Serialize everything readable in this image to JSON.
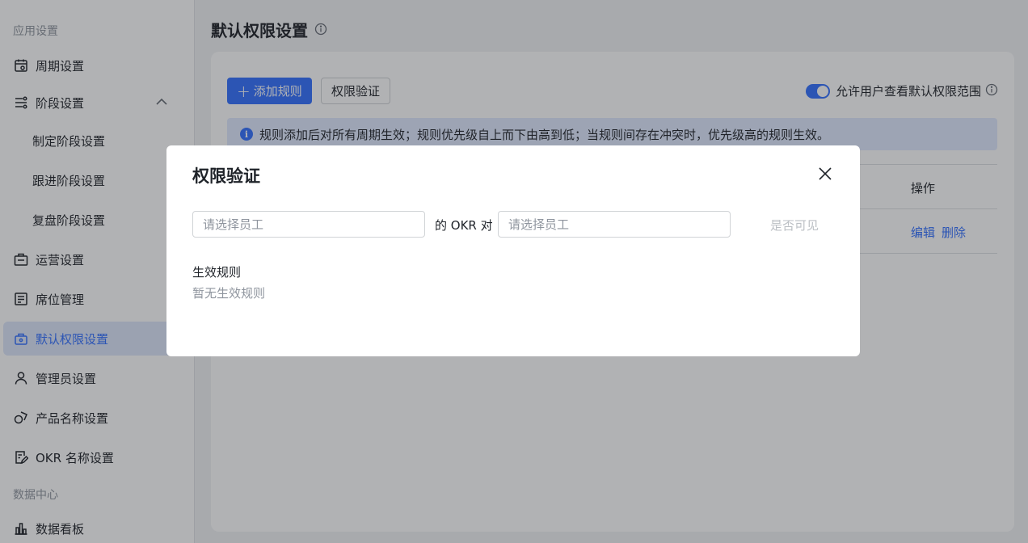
{
  "sidebar": {
    "group_app": "应用设置",
    "group_data": "数据中心",
    "items": [
      {
        "label": "周期设置",
        "icon": "calendar-icon"
      },
      {
        "label": "阶段设置",
        "icon": "stage-icon"
      },
      {
        "label": "制定阶段设置"
      },
      {
        "label": "跟进阶段设置"
      },
      {
        "label": "复盘阶段设置"
      },
      {
        "label": "运营设置",
        "icon": "briefcase-icon"
      },
      {
        "label": "席位管理",
        "icon": "seat-list-icon"
      },
      {
        "label": "默认权限设置",
        "icon": "lock-bag-icon"
      },
      {
        "label": "管理员设置",
        "icon": "user-icon"
      },
      {
        "label": "产品名称设置",
        "icon": "shapes-icon"
      },
      {
        "label": "OKR 名称设置",
        "icon": "edit-doc-icon"
      },
      {
        "label": "数据看板",
        "icon": "bar-chart-icon"
      }
    ]
  },
  "main": {
    "title": "默认权限设置",
    "add_rule_label": "添加规则",
    "verify_label": "权限验证",
    "toggle_label": "允许用户查看默认权限范围",
    "toggle_on": true,
    "notice": "规则添加后对所有周期生效；规则优先级自上而下由高到低；当规则间存在冲突时，优先级高的规则生效。",
    "column_ops": "操作",
    "row_edit": "编辑",
    "row_delete": "删除"
  },
  "modal": {
    "title": "权限验证",
    "select_a_placeholder": "请选择员工",
    "middle_text": "的 OKR 对",
    "select_b_placeholder": "请选择员工",
    "check_label": "是否可见",
    "rules_title": "生效规则",
    "rules_empty": "暂无生效规则"
  },
  "colors": {
    "primary": "#3370ff",
    "active_bg": "#dde6fb",
    "notice_bg": "#e1eaff"
  }
}
